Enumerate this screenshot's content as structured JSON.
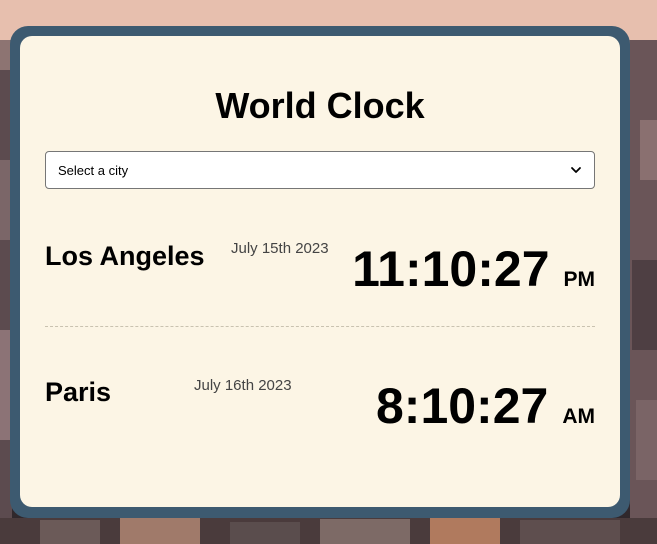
{
  "header": {
    "title": "World Clock"
  },
  "city_select": {
    "selected": "Select a city"
  },
  "cities": [
    {
      "name": "Los Angeles",
      "date": "July 15th 2023",
      "time": "11:10:27",
      "period": "PM"
    },
    {
      "name": "Paris",
      "date": "July 16th 2023",
      "time": "8:10:27",
      "period": "AM"
    }
  ],
  "colors": {
    "frame": "#3d5a70",
    "card": "#fcf5e5",
    "text": "#000000",
    "date_text": "#444444"
  },
  "icons": {
    "select_arrow": "chevron-down-icon"
  }
}
